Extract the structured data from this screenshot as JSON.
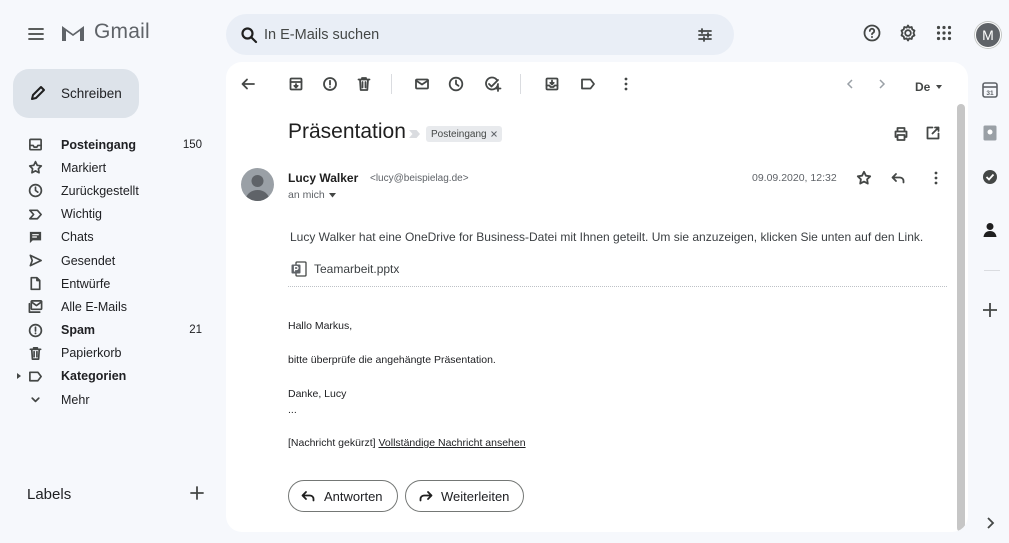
{
  "app": {
    "name": "Gmail",
    "avatar_letter": "M"
  },
  "search": {
    "placeholder": "In E-Mails suchen"
  },
  "sidebar": {
    "compose_label": "Schreiben",
    "items": [
      {
        "label": "Posteingang",
        "count": "150",
        "bold": true,
        "icon": "inbox-icon"
      },
      {
        "label": "Markiert",
        "count": "",
        "bold": false,
        "icon": "star-icon"
      },
      {
        "label": "Zurückgestellt",
        "count": "",
        "bold": false,
        "icon": "clock-icon"
      },
      {
        "label": "Wichtig",
        "count": "",
        "bold": false,
        "icon": "important-icon"
      },
      {
        "label": "Chats",
        "count": "",
        "bold": false,
        "icon": "chat-icon"
      },
      {
        "label": "Gesendet",
        "count": "",
        "bold": false,
        "icon": "send-icon"
      },
      {
        "label": "Entwürfe",
        "count": "",
        "bold": false,
        "icon": "draft-icon"
      },
      {
        "label": "Alle E-Mails",
        "count": "",
        "bold": false,
        "icon": "all-mail-icon"
      },
      {
        "label": "Spam",
        "count": "21",
        "bold": true,
        "icon": "spam-icon"
      },
      {
        "label": "Papierkorb",
        "count": "",
        "bold": false,
        "icon": "trash-icon"
      },
      {
        "label": "Kategorien",
        "count": "",
        "bold": true,
        "icon": "label-icon"
      },
      {
        "label": "Mehr",
        "count": "",
        "bold": false,
        "icon": "chevron-down-icon"
      }
    ],
    "labels_heading": "Labels"
  },
  "toolbar": {
    "language": "De"
  },
  "email": {
    "subject": "Präsentation",
    "badge": "Posteingang",
    "sender_name": "Lucy Walker",
    "sender_email": "<lucy@beispielag.de>",
    "recipient": "an mich",
    "date": "09.09.2020, 12:32",
    "onedrive_text": "Lucy Walker hat eine OneDrive for Business-Datei mit Ihnen geteilt. Um sie anzuzeigen, klicken Sie unten auf den Link.",
    "attachment": "Teamarbeit.pptx",
    "greeting": "Hallo Markus,",
    "body": "bitte überprüfe die angehängte Präsentation.",
    "signoff": "Danke, Lucy",
    "ellipsis": "...",
    "truncated": "[Nachricht gekürzt]",
    "full_message_link": "Vollständige Nachricht ansehen",
    "reply_label": "Antworten",
    "forward_label": "Weiterleiten"
  },
  "colors": {
    "background": "#f6f8fc",
    "compose": "#dde3ea",
    "search": "#e9eef6",
    "avatar": "#5f6368"
  }
}
